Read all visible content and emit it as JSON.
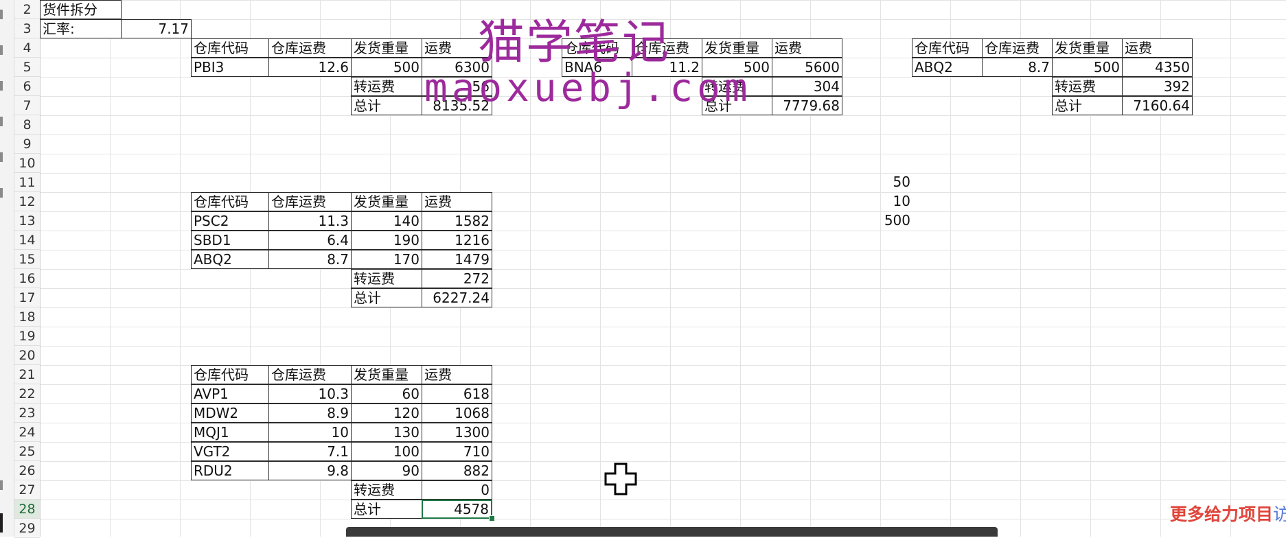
{
  "row_numbers": [
    "2",
    "3",
    "4",
    "5",
    "6",
    "7",
    "8",
    "9",
    "10",
    "11",
    "12",
    "13",
    "14",
    "15",
    "16",
    "17",
    "18",
    "19",
    "20",
    "21",
    "22",
    "23",
    "24",
    "25",
    "26",
    "27",
    "28",
    "29"
  ],
  "header_block": {
    "title": "货件拆分",
    "rate_label": "汇率:",
    "rate_value": "7.17"
  },
  "column_headers": {
    "code": "仓库代码",
    "warehouse_fee": "仓库运费",
    "weight": "发货重量",
    "freight": "运费"
  },
  "labels": {
    "transfer_fee": "转运费",
    "total": "总计"
  },
  "table1": {
    "rows": [
      {
        "code": "PBI3",
        "fee": "12.6",
        "weight": "500",
        "freight": "6300"
      }
    ],
    "transfer": "56",
    "total": "8135.52"
  },
  "table2": {
    "rows": [
      {
        "code": "BNA6",
        "fee": "11.2",
        "weight": "500",
        "freight": "5600"
      }
    ],
    "transfer": "304",
    "total": "7779.68"
  },
  "table3": {
    "rows": [
      {
        "code": "ABQ2",
        "fee": "8.7",
        "weight": "500",
        "freight": "4350"
      }
    ],
    "transfer": "392",
    "total": "7160.64"
  },
  "table4": {
    "rows": [
      {
        "code": "PSC2",
        "fee": "11.3",
        "weight": "140",
        "freight": "1582"
      },
      {
        "code": "SBD1",
        "fee": "6.4",
        "weight": "190",
        "freight": "1216"
      },
      {
        "code": "ABQ2",
        "fee": "8.7",
        "weight": "170",
        "freight": "1479"
      }
    ],
    "transfer": "272",
    "total": "6227.24"
  },
  "table5": {
    "rows": [
      {
        "code": "AVP1",
        "fee": "10.3",
        "weight": "60",
        "freight": "618"
      },
      {
        "code": "MDW2",
        "fee": "8.9",
        "weight": "120",
        "freight": "1068"
      },
      {
        "code": "MQJ1",
        "fee": "10",
        "weight": "130",
        "freight": "1300"
      },
      {
        "code": "VGT2",
        "fee": "7.1",
        "weight": "100",
        "freight": "710"
      },
      {
        "code": "RDU2",
        "fee": "9.8",
        "weight": "90",
        "freight": "882"
      }
    ],
    "transfer": "0",
    "total": "4578"
  },
  "loose_values": [
    "50",
    "10",
    "500"
  ],
  "watermark": {
    "cn": "猫学笔记",
    "url": "maoxuebj.com"
  },
  "promo": {
    "red": "更多给力项目",
    "blue": "访问"
  },
  "colors": {
    "watermark": "#9d2a9c",
    "selection": "#1e7a45",
    "promo_red": "#e0443a",
    "promo_blue": "#5a7bd8"
  },
  "cursor_icon": "move-cross-cursor-icon"
}
